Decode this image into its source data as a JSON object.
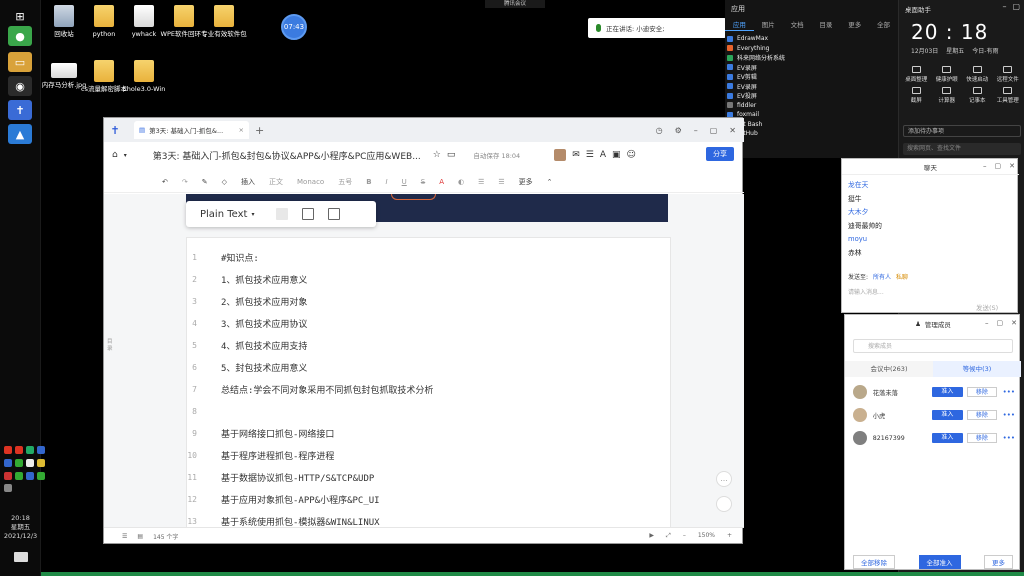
{
  "desktop": {
    "icons": [
      {
        "label": "回收站"
      },
      {
        "label": "python"
      },
      {
        "label": "ywhack"
      },
      {
        "label": "WPE软件回环专"
      },
      {
        "label": "专业有效软件包"
      },
      {
        "label": "内存马分析.jpg"
      },
      {
        "label": "cs流量解密脚本"
      },
      {
        "label": "Ehole3.0-Win"
      }
    ],
    "circle_label": "07:43",
    "top_mic": "腾讯会议",
    "meeting_label": "正在讲话: 小迪安全;"
  },
  "taskbar": {
    "clock_time": "20:18",
    "clock_weekday": "星期五",
    "clock_date": "2021/12/3"
  },
  "start_menu": {
    "title": "应用",
    "tabs": [
      "应用",
      "图片",
      "文档",
      "目录",
      "更多",
      "全部"
    ],
    "items": [
      "EdrawMax",
      "Everything",
      "科来网络分析系统",
      "EV录屏",
      "EV剪辑",
      "EV录屏",
      "EV投屏",
      "fiddler",
      "foxmail",
      "Git Bash",
      "GitHub"
    ]
  },
  "action_center": {
    "title": "桌面助手",
    "time": "20 : 18",
    "date": "12月03日",
    "weekday": "星期五",
    "weather": "今日-有雨",
    "grid": [
      "桌面整理",
      "健康护眼",
      "快速启动",
      "远程文件",
      "截屏",
      "计算器",
      "记事本",
      "工具管理"
    ],
    "todo": "添加待办事项",
    "search": "搜索网页、查找文件"
  },
  "editor": {
    "tab_title": "第3天: 基础入门-抓包&...",
    "doc_title": "第3天: 基础入门-抓包&封包&协议&APP&小程序&PC应用&WEB...",
    "saved": "自动保存 18:04",
    "share": "分享",
    "toolbar": {
      "insert": "插入",
      "body": "正文",
      "font": "Monaco",
      "size": "五号",
      "more": "更多"
    },
    "code_lang": "Plain Text",
    "lines": [
      {
        "n": "1",
        "t": "#知识点:"
      },
      {
        "n": "2",
        "t": "1、抓包技术应用意义"
      },
      {
        "n": "3",
        "t": "2、抓包技术应用对象"
      },
      {
        "n": "4",
        "t": "3、抓包技术应用协议"
      },
      {
        "n": "5",
        "t": "4、抓包技术应用支持"
      },
      {
        "n": "6",
        "t": "5、封包技术应用意义"
      },
      {
        "n": "7",
        "t": "总结点:学会不同对象采用不同抓包封包抓取技术分析"
      },
      {
        "n": "8",
        "t": ""
      },
      {
        "n": "9",
        "t": "基于网络接口抓包-网络接口"
      },
      {
        "n": "10",
        "t": "基于程序进程抓包-程序进程"
      },
      {
        "n": "11",
        "t": "基于数据协议抓包-HTTP/S&TCP&UDP"
      },
      {
        "n": "12",
        "t": "基于应用对象抓包-APP&小程序&PC_UI"
      },
      {
        "n": "13",
        "t": "基于系统使用抓包-模拟器&WIN&LINUX"
      }
    ],
    "side_anchor": "目录",
    "status_words": "145 个字",
    "zoom": "150%"
  },
  "chat": {
    "title": "聊天",
    "messages": [
      {
        "text": "龙在天",
        "color": "#2e67e0"
      },
      {
        "text": "挺牛",
        "color": "#222"
      },
      {
        "text": "大木夕",
        "color": "#2e67e0"
      },
      {
        "text": "迪哥最帅的",
        "color": "#222"
      },
      {
        "text": "moyu",
        "color": "#2e67e0"
      },
      {
        "text": "赤林",
        "color": "#222"
      }
    ],
    "send_to_label": "发送至:",
    "send_to_value": "所有人",
    "private_label": "私聊",
    "input_placeholder": "请输入消息...",
    "send": "发送(S)"
  },
  "members": {
    "title": "管理成员",
    "search_placeholder": "搜索成员",
    "tabs": [
      "会议中(263)",
      "等候中(3)"
    ],
    "rows": [
      {
        "name": "花落未落",
        "admit": "准入",
        "remove": "移除"
      },
      {
        "name": "小虎",
        "admit": "准入",
        "remove": "移除"
      },
      {
        "name": "82167399",
        "admit": "准入",
        "remove": "移除"
      }
    ],
    "foot": [
      "全部移除",
      "全部准入",
      "更多"
    ]
  }
}
